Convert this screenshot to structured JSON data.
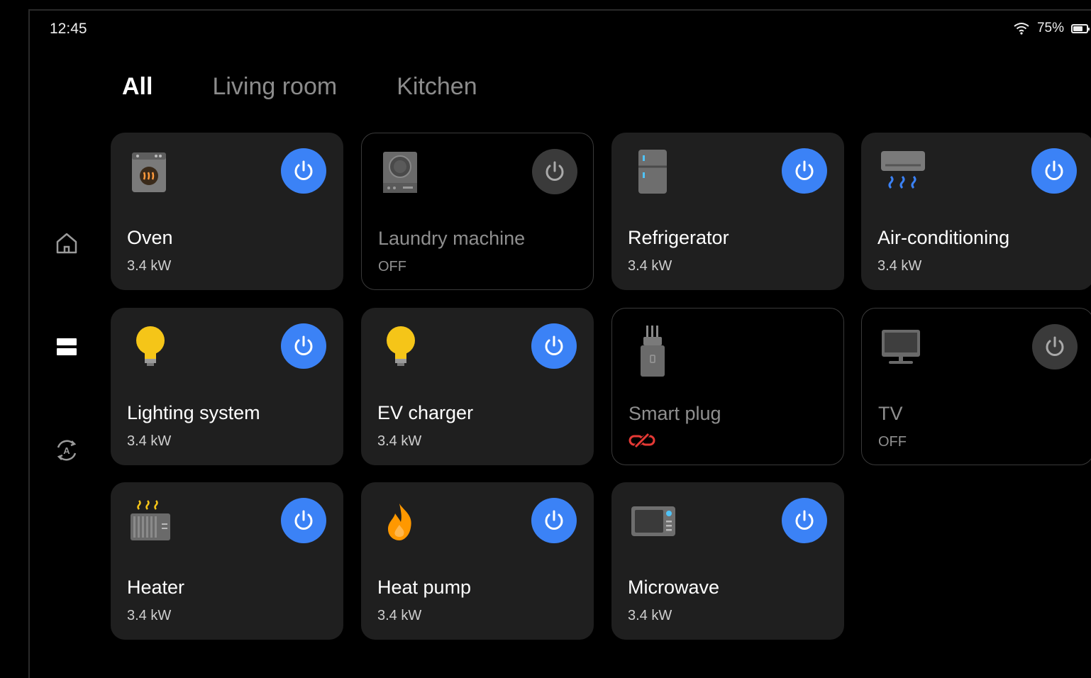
{
  "status": {
    "time": "12:45",
    "battery_text": "75%",
    "battery_level": 0.75
  },
  "tabs": [
    {
      "label": "All",
      "active": true
    },
    {
      "label": "Living room",
      "active": false
    },
    {
      "label": "Kitchen",
      "active": false
    }
  ],
  "nav": [
    {
      "icon": "home-icon"
    },
    {
      "icon": "list-view-icon"
    },
    {
      "icon": "auto-mode-icon"
    }
  ],
  "devices": [
    {
      "name": "Oven",
      "status": "3.4 kW",
      "on": true,
      "icon": "oven-icon"
    },
    {
      "name": "Laundry machine",
      "status": "OFF",
      "on": false,
      "icon": "laundry-machine-icon"
    },
    {
      "name": "Refrigerator",
      "status": "3.4 kW",
      "on": true,
      "icon": "refrigerator-icon"
    },
    {
      "name": "Air-conditioning",
      "status": "3.4 kW",
      "on": true,
      "icon": "air-conditioner-icon"
    },
    {
      "name": "Lighting system",
      "status": "3.4 kW",
      "on": true,
      "icon": "light-bulb-icon"
    },
    {
      "name": "EV charger",
      "status": "3.4 kW",
      "on": true,
      "icon": "light-bulb-icon"
    },
    {
      "name": "Smart plug",
      "status": "",
      "on": false,
      "icon": "smart-plug-icon",
      "status_icon": "disconnected-link-icon"
    },
    {
      "name": "TV",
      "status": "OFF",
      "on": false,
      "icon": "tv-icon"
    },
    {
      "name": "Heater",
      "status": "3.4 kW",
      "on": true,
      "icon": "heater-icon"
    },
    {
      "name": "Heat pump",
      "status": "3.4 kW",
      "on": true,
      "icon": "flame-icon"
    },
    {
      "name": "Microwave",
      "status": "3.4 kW",
      "on": true,
      "icon": "microwave-icon"
    }
  ],
  "colors": {
    "accent": "#3b82f6",
    "card": "#1f1f1f",
    "off_button": "#3a3a3a",
    "bulb": "#f5c518",
    "flame": "#ff9800",
    "alert": "#e53935"
  }
}
